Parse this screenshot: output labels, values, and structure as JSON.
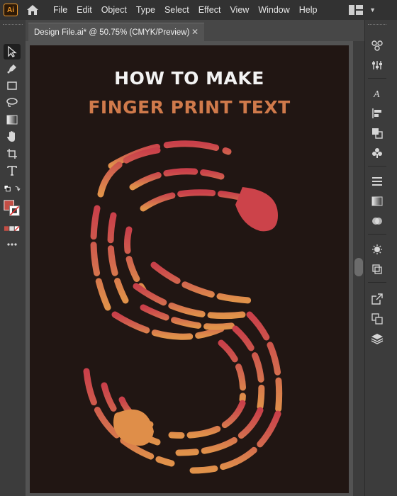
{
  "app": {
    "logo_text": "Ai",
    "brand_color": "#f29b2a"
  },
  "menubar": {
    "items": [
      "File",
      "Edit",
      "Object",
      "Type",
      "Select",
      "Effect",
      "View",
      "Window",
      "Help"
    ]
  },
  "document": {
    "tab_title": "Design File.ai* @ 50.75% (CMYK/Preview)",
    "close_symbol": "✕"
  },
  "artwork": {
    "headline_line1": "HOW TO MAKE",
    "headline_line2": "FINGER PRINT TEXT",
    "background_color": "#211613",
    "gradient_colors": [
      "#c9404a",
      "#d2694e",
      "#e0924a"
    ]
  },
  "left_tools": [
    {
      "icon": "selection-arrow-icon"
    },
    {
      "icon": "pen-icon"
    },
    {
      "icon": "rectangle-icon"
    },
    {
      "icon": "lasso-icon"
    },
    {
      "icon": "gradient-icon"
    },
    {
      "icon": "hand-icon"
    },
    {
      "icon": "artboard-icon"
    },
    {
      "icon": "type-icon"
    },
    {
      "icon": "swap-colors-icon"
    },
    {
      "icon": "fill-stroke-icon"
    },
    {
      "icon": "color-mode-icon"
    },
    {
      "icon": "more-tools-icon"
    }
  ],
  "right_panels": [
    {
      "icon": "libraries-icon"
    },
    {
      "icon": "properties-icon"
    },
    {
      "icon": "character-icon"
    },
    {
      "icon": "align-icon"
    },
    {
      "icon": "pathfinder-icon"
    },
    {
      "icon": "symbols-icon"
    },
    {
      "icon": "stroke-icon"
    },
    {
      "icon": "gradient-panel-icon"
    },
    {
      "icon": "transparency-icon"
    },
    {
      "icon": "appearance-icon"
    },
    {
      "icon": "graphic-styles-icon"
    },
    {
      "icon": "export-icon"
    },
    {
      "icon": "artboards-icon"
    },
    {
      "icon": "layers-icon"
    }
  ]
}
